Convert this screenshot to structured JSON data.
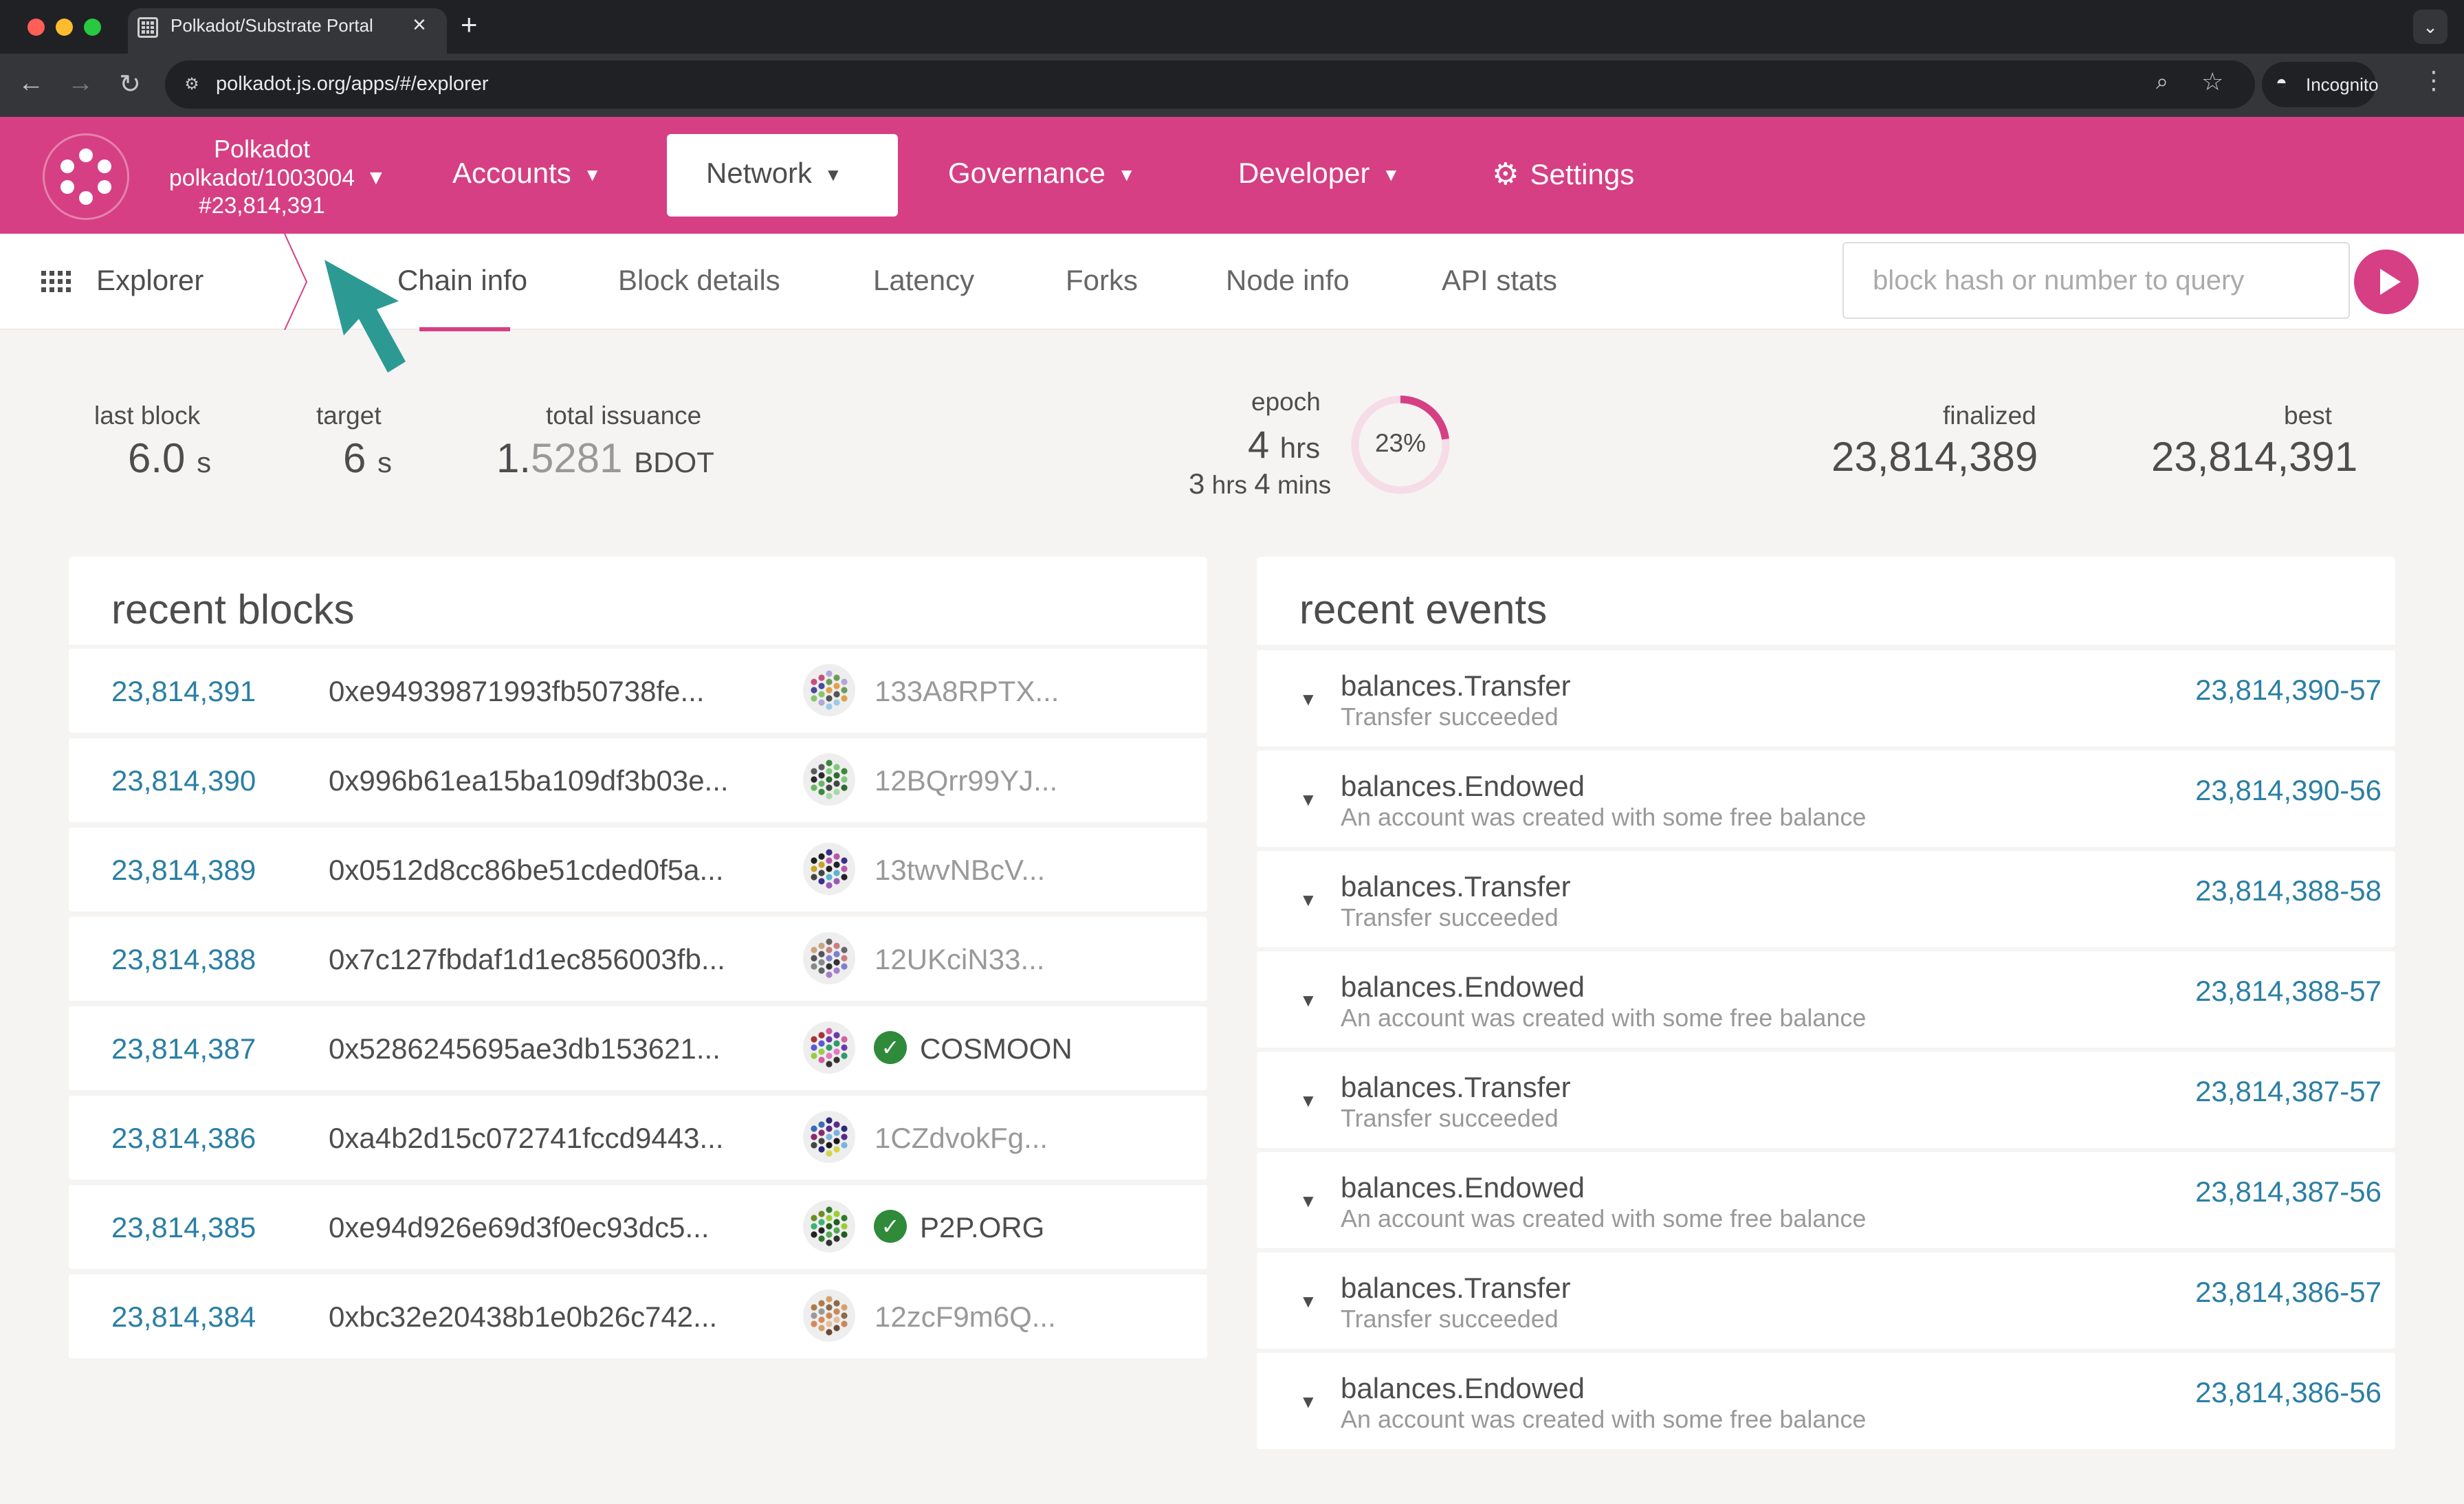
{
  "browser": {
    "tab_title": "Polkadot/Substrate Portal",
    "url": "polkadot.js.org/apps/#/explorer",
    "incognito_label": "Incognito"
  },
  "header": {
    "chain_name": "Polkadot",
    "chain_spec": "polkadot/1003004",
    "chain_block": "#23,814,391",
    "menu": [
      "Accounts",
      "Network",
      "Governance",
      "Developer",
      "Settings"
    ],
    "brand_color": "#d63f83"
  },
  "subnav": {
    "title": "Explorer",
    "tabs": [
      "Chain info",
      "Block details",
      "Latency",
      "Forks",
      "Node info",
      "API stats"
    ],
    "active_tab": "Chain info",
    "search_placeholder": "block hash or number to query"
  },
  "summary": {
    "last_block": {
      "label": "last block",
      "value": "6.0",
      "unit": "s"
    },
    "target": {
      "label": "target",
      "value": "6",
      "unit": "s"
    },
    "total_issuance": {
      "label": "total issuance",
      "value_int": "1.",
      "value_frac": "5281",
      "unit": "BDOT"
    },
    "epoch": {
      "label": "epoch",
      "value": "4",
      "unit": "hrs",
      "sub_h": "3",
      "sub_h_unit": "hrs",
      "sub_m": "4",
      "sub_m_unit": "mins",
      "percent_label": "23%",
      "percent": 0.23
    },
    "finalized": {
      "label": "finalized",
      "value": "23,814,389"
    },
    "best": {
      "label": "best",
      "value": "23,814,391"
    }
  },
  "recent_blocks": {
    "title": "recent blocks",
    "rows": [
      {
        "number": "23,814,391",
        "hash": "0xe94939871993fb50738fe...",
        "author": "133A8RPTX...",
        "verified": false
      },
      {
        "number": "23,814,390",
        "hash": "0x996b61ea15ba109df3b03e...",
        "author": "12BQrr99YJ...",
        "verified": false
      },
      {
        "number": "23,814,389",
        "hash": "0x0512d8cc86be51cded0f5a...",
        "author": "13twvNBcV...",
        "verified": false
      },
      {
        "number": "23,814,388",
        "hash": "0x7c127fbdaf1d1ec856003fb...",
        "author": "12UKciN33...",
        "verified": false
      },
      {
        "number": "23,814,387",
        "hash": "0x5286245695ae3db153621...",
        "author": "COSMOON",
        "verified": true
      },
      {
        "number": "23,814,386",
        "hash": "0xa4b2d15c072741fccd9443...",
        "author": "1CZdvokFg...",
        "verified": false
      },
      {
        "number": "23,814,385",
        "hash": "0xe94d926e69d3f0ec93dc5...",
        "author": "P2P.ORG",
        "verified": true
      },
      {
        "number": "23,814,384",
        "hash": "0xbc32e20438b1e0b26c742...",
        "author": "12zcF9m6Q...",
        "verified": false
      }
    ]
  },
  "recent_events": {
    "title": "recent events",
    "rows": [
      {
        "name": "balances.Transfer",
        "desc": "Transfer succeeded",
        "id": "23,814,390-57"
      },
      {
        "name": "balances.Endowed",
        "desc": "An account was created with some free balance",
        "id": "23,814,390-56"
      },
      {
        "name": "balances.Transfer",
        "desc": "Transfer succeeded",
        "id": "23,814,388-58"
      },
      {
        "name": "balances.Endowed",
        "desc": "An account was created with some free balance",
        "id": "23,814,388-57"
      },
      {
        "name": "balances.Transfer",
        "desc": "Transfer succeeded",
        "id": "23,814,387-57"
      },
      {
        "name": "balances.Endowed",
        "desc": "An account was created with some free balance",
        "id": "23,814,387-56"
      },
      {
        "name": "balances.Transfer",
        "desc": "Transfer succeeded",
        "id": "23,814,386-57"
      },
      {
        "name": "balances.Endowed",
        "desc": "An account was created with some free balance",
        "id": "23,814,386-56"
      }
    ]
  }
}
